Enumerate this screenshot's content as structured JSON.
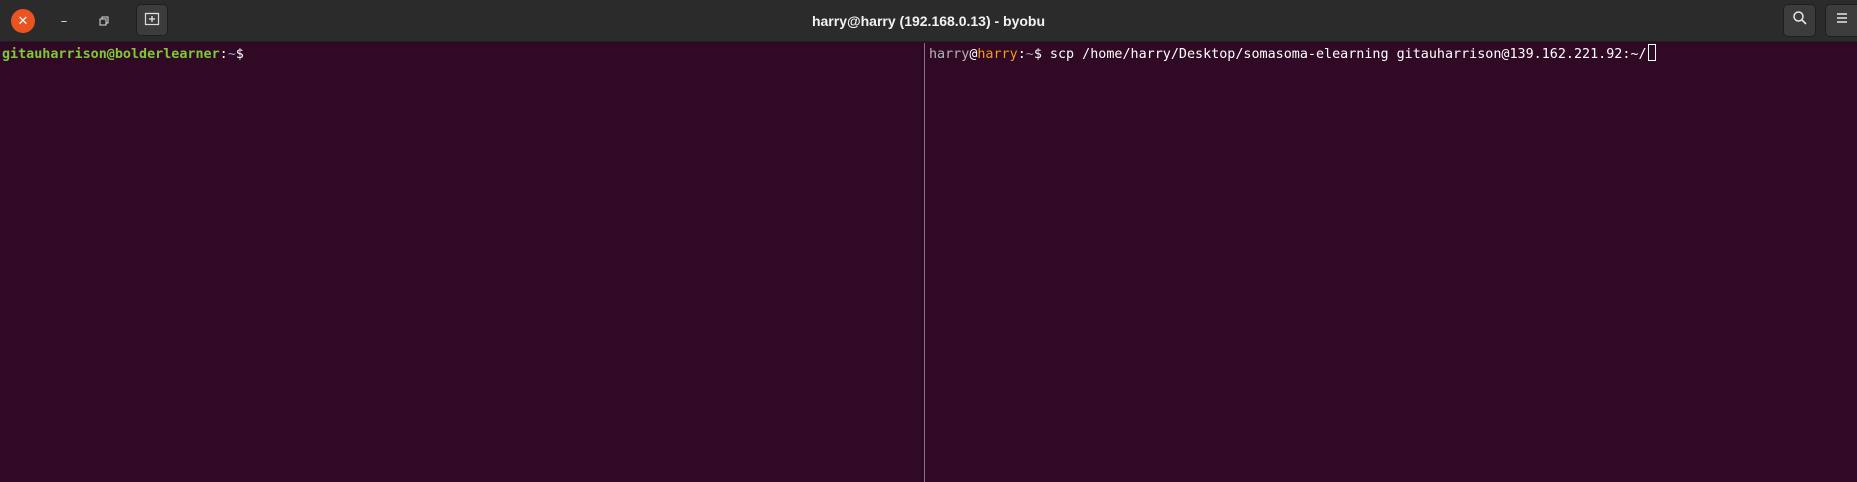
{
  "window": {
    "title": "harry@harry (192.168.0.13) - byobu",
    "controls": {
      "close_icon": "close-icon",
      "minimize_icon": "minimize-icon",
      "maximize_icon": "restore-icon"
    },
    "actions": {
      "new_tab_icon": "new-tab-icon",
      "search_icon": "search-icon",
      "menu_icon": "hamburger-menu-icon"
    }
  },
  "left_pane": {
    "prompt_user_host": "gitauharrison@bolderlearner",
    "prompt_colon": ":",
    "prompt_path": "~",
    "prompt_symbol": "$"
  },
  "right_pane": {
    "prompt_user": "harry",
    "prompt_at": "@",
    "prompt_host": "harry",
    "prompt_colon": ":",
    "prompt_path": "~",
    "prompt_symbol": "$",
    "command": " scp /home/harry/Desktop/somasoma-elearning gitauharrison@139.162.221.92:~/"
  },
  "colors": {
    "terminal_background": "#300a24",
    "header_background": "#2b2b2b",
    "close_button": "#e95420",
    "prompt_green": "#7ec936",
    "prompt_orange": "#f29a18",
    "divider": "#8d6f84"
  }
}
